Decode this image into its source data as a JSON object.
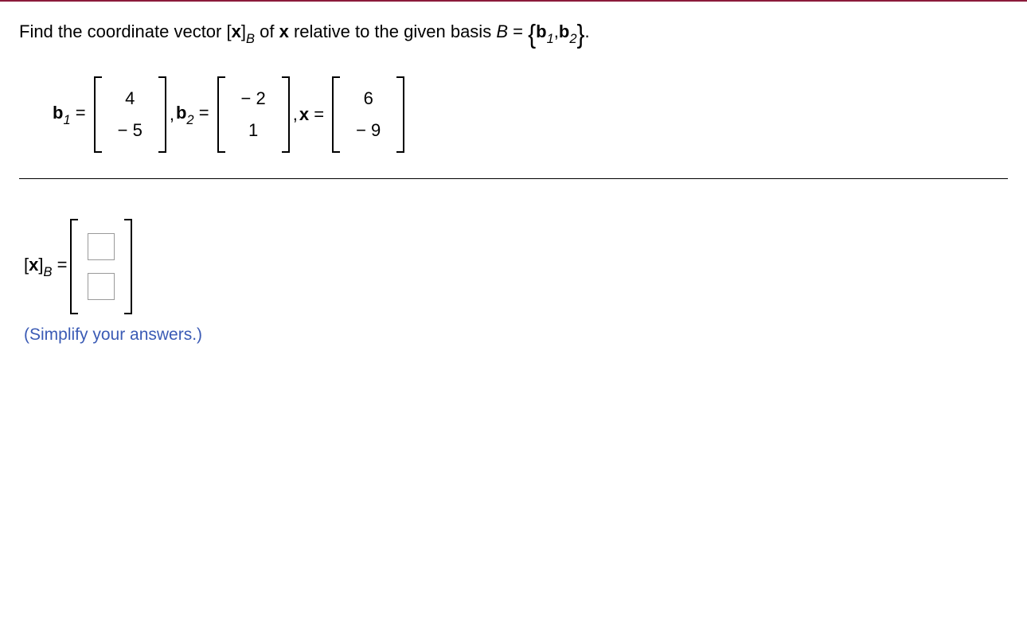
{
  "prompt": {
    "part1": "Find the coordinate vector ",
    "vec_open": "[",
    "vec_x": "x",
    "vec_close": "]",
    "sub_B": "B",
    "part2": " of ",
    "x_bold": "x",
    "part3": " relative to the given basis ",
    "B": "B",
    "eq": " = ",
    "brace_open": "{",
    "b1": "b",
    "one": "1",
    "comma": ",",
    "b2": "b",
    "two": "2",
    "brace_close": "}",
    "period": "."
  },
  "vectors": {
    "b1_label_b": "b",
    "b1_label_1": "1",
    "eqs": " = ",
    "b1": [
      "4",
      "− 5"
    ],
    "sep": ", ",
    "b2_label_b": "b",
    "b2_label_2": "2",
    "b2": [
      "− 2",
      "1"
    ],
    "x_label": "x",
    "x": [
      "6",
      "− 9"
    ]
  },
  "answer": {
    "lhs_open": "[",
    "lhs_x": "x",
    "lhs_close": "]",
    "lhs_sub": "B",
    "eq": " = "
  },
  "hint": "(Simplify your answers.)"
}
